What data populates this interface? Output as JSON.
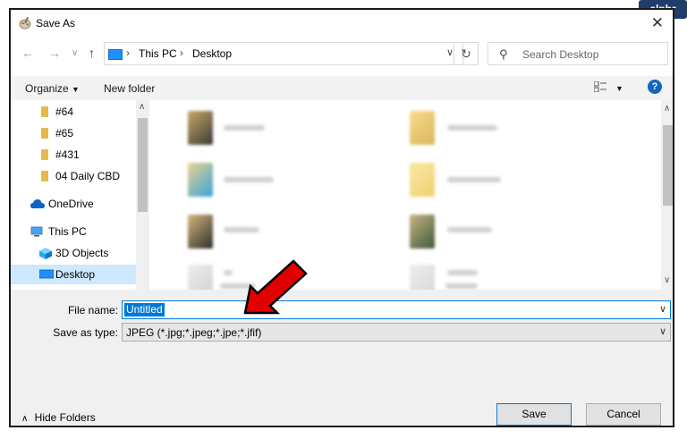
{
  "brand": "alphr",
  "window": {
    "title": "Save As",
    "close_icon": "close-icon"
  },
  "nav": {
    "back_icon": "back-arrow-icon",
    "forward_icon": "forward-arrow-icon",
    "recent_icon": "chevron-down-icon",
    "up_icon": "up-arrow-icon",
    "breadcrumb": [
      "This PC",
      "Desktop"
    ],
    "refresh_icon": "refresh-icon",
    "search_placeholder": "Search Desktop"
  },
  "cmdbar": {
    "organize": "Organize",
    "new_folder": "New folder",
    "help": "?"
  },
  "sidebar": {
    "items": [
      {
        "label": "#64",
        "icon": "folder-icon"
      },
      {
        "label": "#65",
        "icon": "folder-icon"
      },
      {
        "label": "#431",
        "icon": "folder-icon"
      },
      {
        "label": "04 Daily CBD",
        "icon": "folder-icon"
      },
      {
        "label": "OneDrive",
        "icon": "cloud-icon"
      },
      {
        "label": "This PC",
        "icon": "pc-icon"
      },
      {
        "label": "3D Objects",
        "icon": "cube-icon"
      },
      {
        "label": "Desktop",
        "icon": "desktop-icon",
        "selected": true
      }
    ]
  },
  "form": {
    "file_name_label": "File name:",
    "file_name_value": "Untitled",
    "save_type_label": "Save as type:",
    "save_type_value": "JPEG (*.jpg;*.jpeg;*.jpe;*.jfif)"
  },
  "footer": {
    "hide_folders": "Hide Folders",
    "save": "Save",
    "cancel": "Cancel"
  },
  "colors": {
    "accent": "#0078d7",
    "selection": "#cde8ff",
    "annotation": "#e00000"
  }
}
